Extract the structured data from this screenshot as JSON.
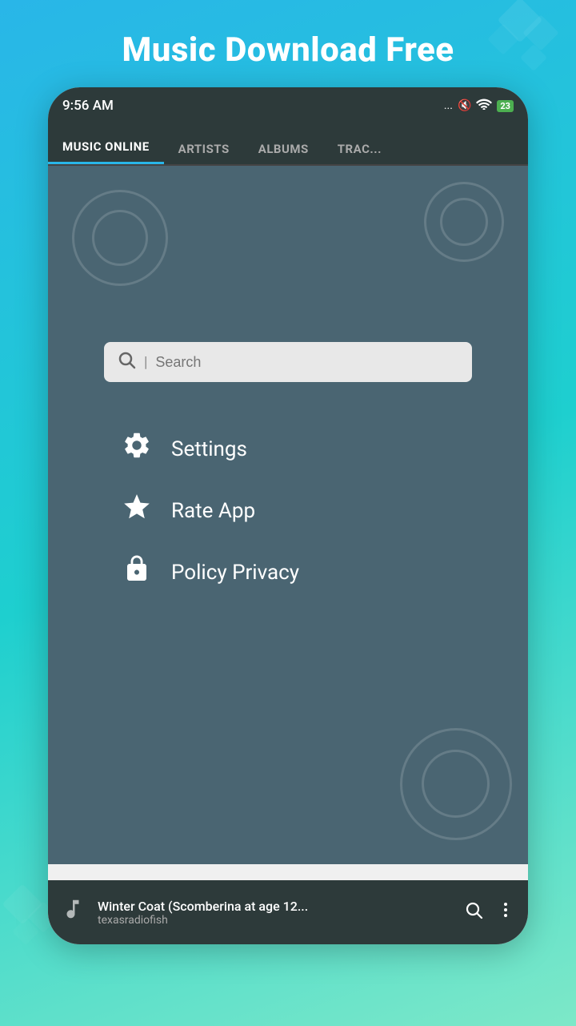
{
  "app": {
    "title": "Music Download Free"
  },
  "status_bar": {
    "time": "9:56  AM",
    "battery": "23",
    "signal_dots": "..."
  },
  "tabs": [
    {
      "id": "music-online",
      "label": "MUSIC ONLINE",
      "active": true
    },
    {
      "id": "artists",
      "label": "ARTISTS",
      "active": false
    },
    {
      "id": "albums",
      "label": "ALBUMS",
      "active": false
    },
    {
      "id": "tracks",
      "label": "TRAC...",
      "active": false
    }
  ],
  "search": {
    "placeholder": "Search"
  },
  "menu_items": [
    {
      "id": "settings",
      "label": "Settings",
      "icon": "gear"
    },
    {
      "id": "rate-app",
      "label": "Rate App",
      "icon": "star"
    },
    {
      "id": "policy-privacy",
      "label": "Policy Privacy",
      "icon": "lock"
    }
  ],
  "player": {
    "title": "Winter Coat (Scomberina at age 12...",
    "artist": "texasradiofish",
    "icon": "music-note"
  },
  "colors": {
    "teal_dark": "#4a6572",
    "bg_gradient_start": "#29b6e8",
    "bg_gradient_end": "#7de8c8",
    "status_bar_bg": "#2d3a3a",
    "tab_active_color": "#29b6e8",
    "white": "#ffffff"
  }
}
